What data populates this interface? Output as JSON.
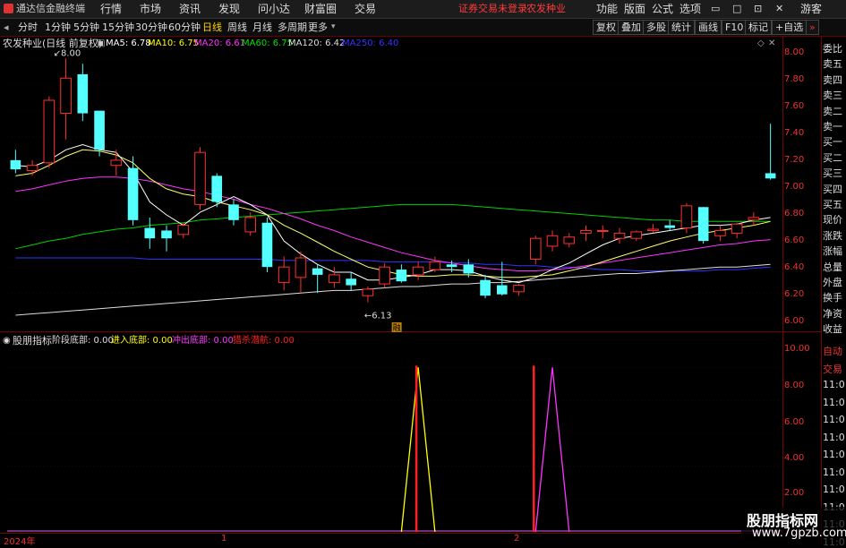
{
  "window": {
    "app_name": "通达信金融终端",
    "menu": [
      "行情",
      "市场",
      "资讯",
      "发现",
      "问小达",
      "财富圈",
      "交易"
    ],
    "status_warning": "证券交易未登录",
    "stock_name_header": "农发种业",
    "right_menu": [
      "功能",
      "版面",
      "公式",
      "选项"
    ],
    "guest": "游客"
  },
  "periods": [
    "分时",
    "1分钟",
    "5分钟",
    "15分钟",
    "30分钟",
    "60分钟",
    "日线",
    "周线",
    "月线",
    "多周期",
    "更多"
  ],
  "selected_period": "日线",
  "right_buttons": [
    "复权",
    "叠加",
    "多股",
    "统计",
    "画线",
    "F10",
    "标记",
    "+自选"
  ],
  "main_chart": {
    "title": "农发种业(日线 前复权)",
    "ma": [
      {
        "label": "MA5: 6.78",
        "color": "#ffffff"
      },
      {
        "label": "MA10: 6.75",
        "color": "#ffff00"
      },
      {
        "label": "MA20: 6.61",
        "color": "#ff33ff"
      },
      {
        "label": "MA60: 6.75",
        "color": "#00e000"
      },
      {
        "label": "MA120: 6.42",
        "color": "#dddddd"
      },
      {
        "label": "MA250: 6.40",
        "color": "#3333ff"
      }
    ],
    "high_marker": "8.00",
    "low_marker": "6.13",
    "event_badge": "融",
    "y_labels": [
      "8.00",
      "7.80",
      "7.60",
      "7.40",
      "7.20",
      "7.00",
      "6.80",
      "6.60",
      "6.40",
      "6.20",
      "6.00"
    ]
  },
  "indicator": {
    "name": "股朋指标",
    "items": [
      {
        "label": "阶段底部: 0.00",
        "color": "#dddddd"
      },
      {
        "label": "进入底部: 0.00",
        "color": "#ffff00"
      },
      {
        "label": "冲出底部: 0.00",
        "color": "#ff33ff"
      },
      {
        "label": "猎杀潜航: 0.00",
        "color": "#ff2020"
      }
    ],
    "y_labels": [
      "10.00",
      "8.00",
      "6.00",
      "4.00",
      "2.00"
    ]
  },
  "x_axis": [
    "2024年",
    "1",
    "2"
  ],
  "side_panel": {
    "top": [
      "委比",
      "卖五",
      "卖四",
      "卖三",
      "卖二",
      "卖一",
      "买一",
      "买二",
      "买三",
      "买四",
      "买五",
      "现价",
      "涨跌",
      "涨幅",
      "总量",
      "外盘",
      "换手",
      "净资",
      "收益"
    ],
    "bottom": [
      "自动",
      "交易",
      "11:0",
      "11:0",
      "11:0",
      "11:0",
      "11:0",
      "11:0",
      "11:0",
      "11:0",
      "11:0",
      "11:0"
    ]
  },
  "watermark": {
    "line1": "股朋指标网",
    "line2": "www.7gpzb.com"
  },
  "chart_data": {
    "type": "candlestick",
    "candles": [
      {
        "o": 7.22,
        "h": 7.3,
        "c": 7.15,
        "l": 7.12
      },
      {
        "o": 7.14,
        "h": 7.22,
        "c": 7.18,
        "l": 7.1
      },
      {
        "o": 7.2,
        "h": 7.71,
        "c": 7.68,
        "l": 7.16
      },
      {
        "o": 7.58,
        "h": 8.0,
        "c": 7.85,
        "l": 7.38
      },
      {
        "o": 7.88,
        "h": 7.96,
        "c": 7.58,
        "l": 7.52
      },
      {
        "o": 7.6,
        "h": 7.58,
        "c": 7.3,
        "l": 7.25
      },
      {
        "o": 7.18,
        "h": 7.3,
        "c": 7.22,
        "l": 7.1
      },
      {
        "o": 7.16,
        "h": 7.25,
        "c": 6.76,
        "l": 6.72
      },
      {
        "o": 6.7,
        "h": 6.78,
        "c": 6.62,
        "l": 6.54
      },
      {
        "o": 6.68,
        "h": 6.72,
        "c": 6.62,
        "l": 6.52
      },
      {
        "o": 6.65,
        "h": 6.74,
        "c": 6.72,
        "l": 6.62
      },
      {
        "o": 6.88,
        "h": 7.32,
        "c": 7.28,
        "l": 6.84
      },
      {
        "o": 7.1,
        "h": 7.12,
        "c": 6.9,
        "l": 6.86
      },
      {
        "o": 6.88,
        "h": 6.92,
        "c": 6.76,
        "l": 6.72
      },
      {
        "o": 6.67,
        "h": 6.82,
        "c": 6.78,
        "l": 6.64
      },
      {
        "o": 6.74,
        "h": 6.78,
        "c": 6.4,
        "l": 6.36
      },
      {
        "o": 6.28,
        "h": 6.48,
        "c": 6.4,
        "l": 6.22
      },
      {
        "o": 6.32,
        "h": 6.52,
        "c": 6.47,
        "l": 6.2
      },
      {
        "o": 6.39,
        "h": 6.42,
        "c": 6.34,
        "l": 6.2
      },
      {
        "o": 6.28,
        "h": 6.4,
        "c": 6.34,
        "l": 6.24
      },
      {
        "o": 6.31,
        "h": 6.36,
        "c": 6.26,
        "l": 6.22
      },
      {
        "o": 6.18,
        "h": 6.25,
        "c": 6.23,
        "l": 6.13
      },
      {
        "o": 6.27,
        "h": 6.43,
        "c": 6.4,
        "l": 6.24
      },
      {
        "o": 6.38,
        "h": 6.42,
        "c": 6.29,
        "l": 6.28
      },
      {
        "o": 6.34,
        "h": 6.44,
        "c": 6.4,
        "l": 6.3
      },
      {
        "o": 6.38,
        "h": 6.48,
        "c": 6.44,
        "l": 6.36
      },
      {
        "o": 6.42,
        "h": 6.45,
        "c": 6.4,
        "l": 6.36
      },
      {
        "o": 6.42,
        "h": 6.46,
        "c": 6.35,
        "l": 6.32
      },
      {
        "o": 6.3,
        "h": 6.34,
        "c": 6.18,
        "l": 6.16
      },
      {
        "o": 6.26,
        "h": 6.44,
        "c": 6.19,
        "l": 6.18
      },
      {
        "o": 6.21,
        "h": 6.27,
        "c": 6.26,
        "l": 6.18
      },
      {
        "o": 6.46,
        "h": 6.64,
        "c": 6.62,
        "l": 6.42
      },
      {
        "o": 6.56,
        "h": 6.68,
        "c": 6.64,
        "l": 6.52
      },
      {
        "o": 6.58,
        "h": 6.66,
        "c": 6.63,
        "l": 6.55
      },
      {
        "o": 6.66,
        "h": 6.72,
        "c": 6.68,
        "l": 6.6
      },
      {
        "o": 6.68,
        "h": 6.72,
        "c": 6.68,
        "l": 6.62
      },
      {
        "o": 6.62,
        "h": 6.7,
        "c": 6.66,
        "l": 6.58
      },
      {
        "o": 6.62,
        "h": 6.68,
        "c": 6.67,
        "l": 6.6
      },
      {
        "o": 6.68,
        "h": 6.73,
        "c": 6.69,
        "l": 6.66
      },
      {
        "o": 6.72,
        "h": 6.76,
        "c": 6.7,
        "l": 6.68
      },
      {
        "o": 6.7,
        "h": 6.89,
        "c": 6.87,
        "l": 6.66
      },
      {
        "o": 6.86,
        "h": 6.86,
        "c": 6.6,
        "l": 6.58
      },
      {
        "o": 6.64,
        "h": 6.72,
        "c": 6.68,
        "l": 6.6
      },
      {
        "o": 6.66,
        "h": 6.74,
        "c": 6.73,
        "l": 6.62
      },
      {
        "o": 6.76,
        "h": 6.82,
        "c": 6.78,
        "l": 6.72
      },
      {
        "o": 7.12,
        "h": 7.5,
        "c": 7.08,
        "l": 7.07
      }
    ],
    "ma5": [
      7.18,
      7.17,
      7.22,
      7.3,
      7.34,
      7.3,
      7.28,
      7.13,
      6.9,
      6.8,
      6.72,
      6.82,
      6.88,
      6.94,
      6.88,
      6.8,
      6.6,
      6.5,
      6.42,
      6.36,
      6.36,
      6.3,
      6.3,
      6.32,
      6.34,
      6.38,
      6.38,
      6.37,
      6.33,
      6.3,
      6.28,
      6.32,
      6.38,
      6.43,
      6.5,
      6.57,
      6.62,
      6.64,
      6.66,
      6.68,
      6.7,
      6.72,
      6.72,
      6.73,
      6.76,
      6.78
    ],
    "ma10": [
      7.1,
      7.12,
      7.18,
      7.25,
      7.3,
      7.29,
      7.26,
      7.2,
      7.08,
      7.0,
      6.96,
      6.94,
      6.9,
      6.87,
      6.84,
      6.8,
      6.72,
      6.66,
      6.59,
      6.52,
      6.46,
      6.4,
      6.37,
      6.34,
      6.33,
      6.33,
      6.34,
      6.34,
      6.33,
      6.32,
      6.32,
      6.33,
      6.34,
      6.37,
      6.4,
      6.44,
      6.48,
      6.52,
      6.56,
      6.6,
      6.63,
      6.66,
      6.68,
      6.7,
      6.72,
      6.75
    ],
    "ma20": [
      6.98,
      7.0,
      7.03,
      7.06,
      7.08,
      7.09,
      7.09,
      7.08,
      7.06,
      7.03,
      7.0,
      6.98,
      6.95,
      6.92,
      6.88,
      6.85,
      6.81,
      6.77,
      6.72,
      6.68,
      6.63,
      6.59,
      6.55,
      6.51,
      6.48,
      6.45,
      6.43,
      6.41,
      6.39,
      6.38,
      6.37,
      6.37,
      6.38,
      6.39,
      6.41,
      6.43,
      6.45,
      6.47,
      6.49,
      6.51,
      6.53,
      6.55,
      6.57,
      6.58,
      6.6,
      6.61
    ],
    "ma60": [
      6.54,
      6.57,
      6.6,
      6.62,
      6.65,
      6.67,
      6.69,
      6.7,
      6.72,
      6.73,
      6.74,
      6.76,
      6.77,
      6.78,
      6.79,
      6.8,
      6.81,
      6.82,
      6.83,
      6.84,
      6.85,
      6.86,
      6.87,
      6.88,
      6.88,
      6.88,
      6.88,
      6.87,
      6.86,
      6.85,
      6.84,
      6.83,
      6.82,
      6.81,
      6.8,
      6.79,
      6.78,
      6.77,
      6.76,
      6.76,
      6.75,
      6.75,
      6.75,
      6.75,
      6.75,
      6.75
    ],
    "ma120": [
      6.03,
      6.04,
      6.05,
      6.06,
      6.07,
      6.08,
      6.09,
      6.1,
      6.11,
      6.12,
      6.13,
      6.14,
      6.15,
      6.16,
      6.17,
      6.18,
      6.19,
      6.2,
      6.21,
      6.22,
      6.22,
      6.23,
      6.24,
      6.25,
      6.25,
      6.26,
      6.27,
      6.27,
      6.28,
      6.28,
      6.29,
      6.3,
      6.31,
      6.32,
      6.33,
      6.34,
      6.35,
      6.35,
      6.36,
      6.37,
      6.38,
      6.39,
      6.4,
      6.4,
      6.41,
      6.42
    ],
    "ma250": [
      6.47,
      6.47,
      6.47,
      6.47,
      6.47,
      6.47,
      6.47,
      6.47,
      6.46,
      6.46,
      6.46,
      6.46,
      6.46,
      6.46,
      6.46,
      6.46,
      6.45,
      6.45,
      6.45,
      6.45,
      6.45,
      6.45,
      6.44,
      6.44,
      6.44,
      6.44,
      6.43,
      6.43,
      6.42,
      6.42,
      6.41,
      6.41,
      6.4,
      6.4,
      6.39,
      6.38,
      6.38,
      6.37,
      6.37,
      6.37,
      6.37,
      6.37,
      6.38,
      6.38,
      6.39,
      6.4
    ],
    "ylim": [
      5.92,
      8.12
    ],
    "indicator_ylim": [
      0,
      11
    ],
    "indicator_signals": [
      {
        "type": "进入底部",
        "candle": 24,
        "value": 10,
        "color": "#ffff00"
      },
      {
        "type": "猎杀潜航",
        "candle": 24,
        "value": 10,
        "color": "#ff2020"
      },
      {
        "type": "猎杀潜航",
        "candle": 31,
        "value": 10,
        "color": "#ff2020"
      },
      {
        "type": "冲出底部",
        "candle": 32,
        "value": 10,
        "color": "#ff33ff"
      }
    ]
  }
}
